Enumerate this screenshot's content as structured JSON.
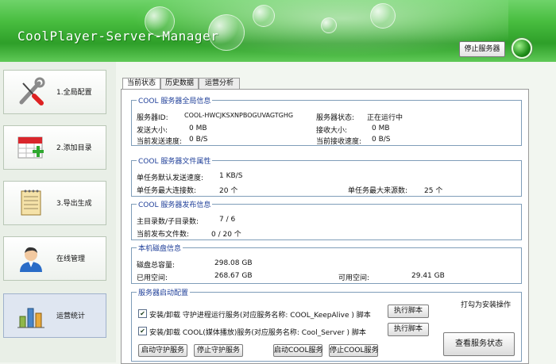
{
  "header": {
    "title": "CoolPlayer-Server-Manager",
    "stop_server_label": "停止服务器"
  },
  "sidebar": {
    "items": [
      {
        "label": "1.全局配置",
        "icon": "wrench-screwdriver-icon"
      },
      {
        "label": "2.添加目录",
        "icon": "calendar-add-icon"
      },
      {
        "label": "3.导出生成",
        "icon": "notepad-icon"
      },
      {
        "label": "在线管理",
        "icon": "user-avatar-icon"
      },
      {
        "label": "运营统计",
        "icon": "bar-chart-icon"
      }
    ]
  },
  "tabs": [
    "当前状态",
    "历史数据",
    "运营分析"
  ],
  "global_info": {
    "title": "COOL 服务器全局信息",
    "server_id_label": "服务器ID:",
    "server_id": "COOL-HWCJKSXNPBOGUVAGTGHG",
    "status_label": "服务器状态:",
    "status": "正在运行中",
    "sent_label": "发送大小:",
    "sent": "0 MB",
    "recv_label": "接收大小:",
    "recv": "0 MB",
    "send_speed_label": "当前发送速度:",
    "send_speed": "0 B/S",
    "recv_speed_label": "当前接收速度:",
    "recv_speed": "0 B/S"
  },
  "file_attr": {
    "title": "COOL 服务器文件属性",
    "default_speed_label": "单任务默认发送速度:",
    "default_speed": "1 KB/S",
    "max_conn_label": "单任务最大连接数:",
    "max_conn": "20 个",
    "max_src_label": "单任务最大来源数:",
    "max_src": "25 个"
  },
  "publish": {
    "title": "COOL 服务器发布信息",
    "dirs_label": "主目录数/子目录数:",
    "dirs": "7 / 6",
    "files_label": "当前发布文件数:",
    "files": "0 / 20 个"
  },
  "disk": {
    "title": "本机磁盘信息",
    "total_label": "磁盘总容量:",
    "total": "298.08 GB",
    "used_label": "已用空间:",
    "used": "268.67 GB",
    "free_label": "可用空间:",
    "free": "29.41 GB"
  },
  "startup": {
    "title": "服务器启动配置",
    "hint": "打勾为安装操作",
    "row1": "安装/卸载  守护进程运行服务(对应服务名称: COOL_KeepAlive ) 脚本",
    "row2": "安装/卸载  COOL(媒体播放)服务(对应服务名称: Cool_Server  ) 脚本",
    "exec_label": "执行脚本",
    "start_guard": "启动守护服务",
    "stop_guard": "停止守护服务",
    "start_cool": "启动COOL服务",
    "stop_cool": "停止COOL服务",
    "check_status": "查看服务状态"
  }
}
